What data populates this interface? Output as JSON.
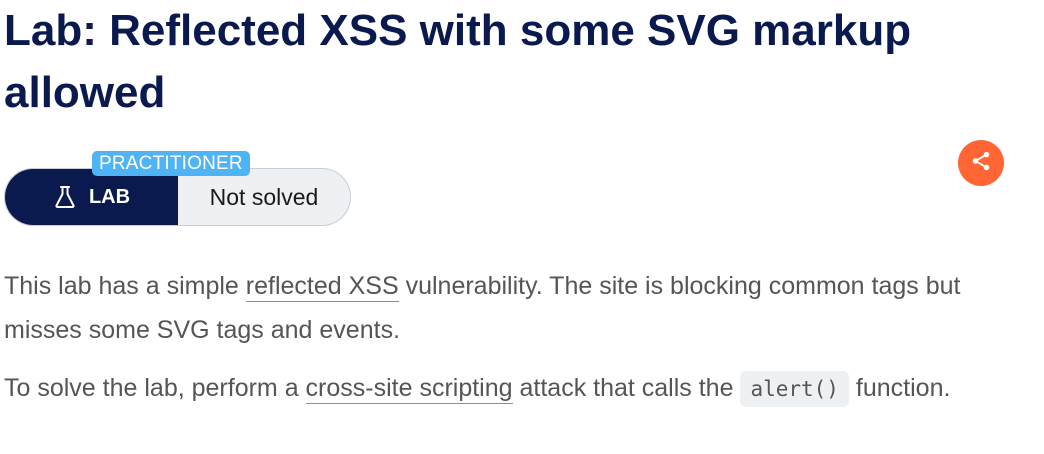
{
  "page": {
    "title": "Lab: Reflected XSS with some SVG markup allowed"
  },
  "badge": {
    "level": "PRACTITIONER",
    "type_label": "LAB",
    "status": "Not solved",
    "type_icon": "flask-icon"
  },
  "share": {
    "icon": "share-icon",
    "color": "#ff6633"
  },
  "description": {
    "p1": {
      "before": "This lab has a simple ",
      "link": "reflected XSS",
      "after": " vulnerability. The site is blocking common tags but misses some SVG tags and events."
    },
    "p2": {
      "before": "To solve the lab, perform a ",
      "link": "cross-site scripting",
      "middle": " attack that calls the ",
      "code": "alert()",
      "after": " function."
    }
  },
  "colors": {
    "title": "#0a1a4f",
    "lab_dark": "#0a1a4f",
    "level_tag": "#4fb4f5",
    "link_underline": "#ff6633"
  }
}
